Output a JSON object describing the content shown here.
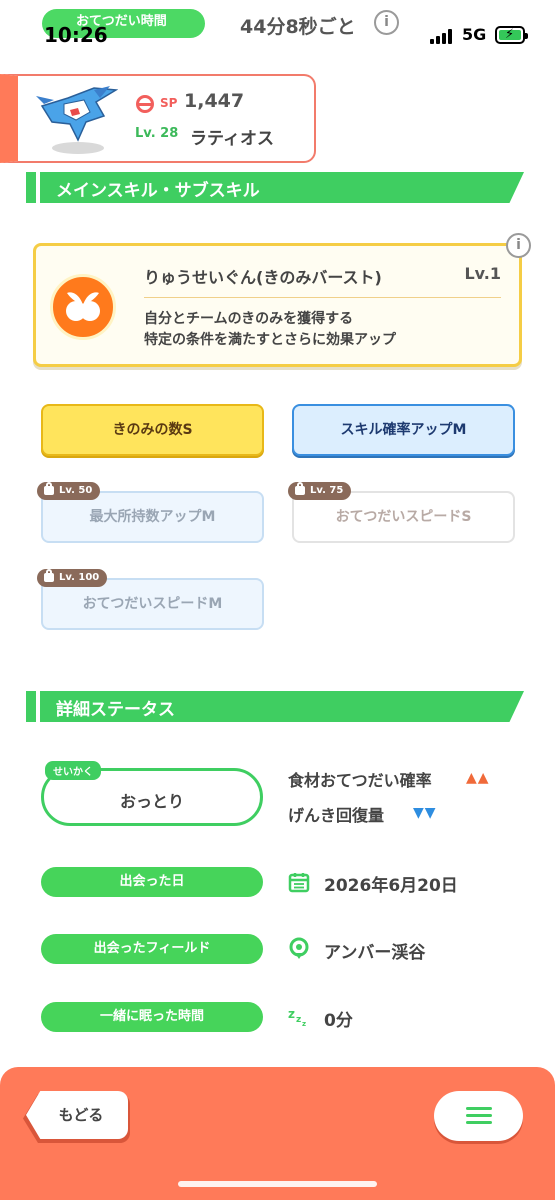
{
  "status_bar": {
    "help_pill_label": "おてつだい時間",
    "clock": "10:26",
    "interval": "44分8秒ごと",
    "network": "5G"
  },
  "pokemon": {
    "sp_label": "SP",
    "sp_value": "1,447",
    "level_label": "Lv. 28",
    "name": "ラティオス"
  },
  "skills_section": {
    "title": "メインスキル・サブスキル",
    "main_skill": {
      "name": "りゅうせいぐん(きのみバースト)",
      "level": "Lv.1",
      "description_line1": "自分とチームのきのみを獲得する",
      "description_line2": "特定の条件を満たすとさらに効果アップ"
    },
    "sub_skills": [
      {
        "label": "きのみの数S",
        "lock_level": null
      },
      {
        "label": "スキル確率アップM",
        "lock_level": null
      },
      {
        "label": "最大所持数アップM",
        "lock_level": "Lv. 50"
      },
      {
        "label": "おてつだいスピードS",
        "lock_level": "Lv. 75"
      },
      {
        "label": "おてつだいスピードM",
        "lock_level": "Lv. 100"
      }
    ]
  },
  "details_section": {
    "title": "詳細ステータス",
    "nature_tag": "せいかく",
    "nature": "おっとり",
    "up_stat": "食材おてつだい確率",
    "up_arrows": "▲▲",
    "down_stat": "げんき回復量",
    "down_arrows": "▼▼",
    "rows": [
      {
        "label": "出会った日",
        "value": "2026年6月20日",
        "icon": "calendar-icon"
      },
      {
        "label": "出会ったフィールド",
        "value": "アンバー渓谷",
        "icon": "location-pin-icon"
      },
      {
        "label": "一緒に眠った時間",
        "value": "0分",
        "icon": "sleep-zzz-icon"
      }
    ]
  },
  "bottom_bar": {
    "back_label": "もどる"
  },
  "colors": {
    "accent_green": "#3fce61",
    "accent_orange": "#ff7a59",
    "skill_gold": "#f5cd45",
    "up_red": "#f06a3a",
    "down_blue": "#2e8de0"
  }
}
